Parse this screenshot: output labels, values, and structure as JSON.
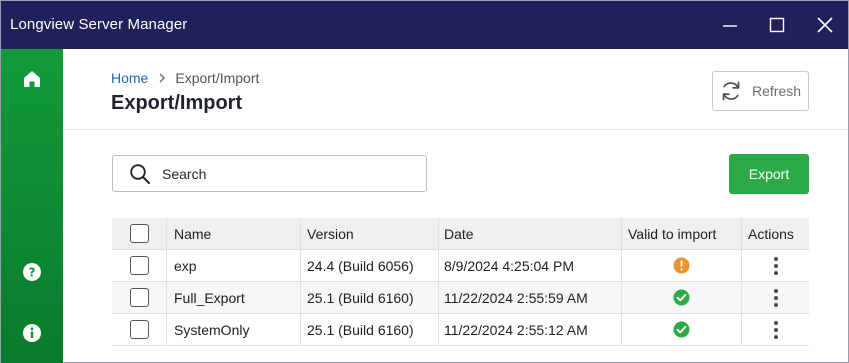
{
  "window": {
    "title": "Longview Server Manager",
    "controls": [
      "minimize-icon",
      "maximize-icon",
      "close-icon"
    ]
  },
  "sidebar": {
    "items": [
      {
        "icon": "home-icon"
      },
      {
        "icon": "help-icon"
      },
      {
        "icon": "info-icon"
      }
    ],
    "color": "#129a3a"
  },
  "header": {
    "breadcrumb": {
      "home": "Home",
      "current": "Export/Import"
    },
    "title": "Export/Import",
    "refresh_label": "Refresh"
  },
  "toolbar": {
    "search_placeholder": "Search",
    "export_label": "Export",
    "export_color": "#2daa48"
  },
  "table": {
    "columns": [
      "Name",
      "Version",
      "Date",
      "Valid to import",
      "Actions"
    ],
    "rows": [
      {
        "name": "exp",
        "version": "24.4 (Build 6056)",
        "date": "8/9/2024 4:25:04 PM",
        "valid": "warning",
        "valid_icon": "warning-icon"
      },
      {
        "name": "Full_Export",
        "version": "25.1 (Build 6160)",
        "date": "11/22/2024 2:55:59 AM",
        "valid": "valid",
        "valid_icon": "check-circle-icon"
      },
      {
        "name": "SystemOnly",
        "version": "25.1 (Build 6160)",
        "date": "11/22/2024 2:55:12 AM",
        "valid": "valid",
        "valid_icon": "check-circle-icon"
      }
    ]
  },
  "colors": {
    "titlebar": "#20205a",
    "link": "#1a66c2",
    "status_warning": "#f0932b",
    "status_ok": "#2daa48"
  }
}
